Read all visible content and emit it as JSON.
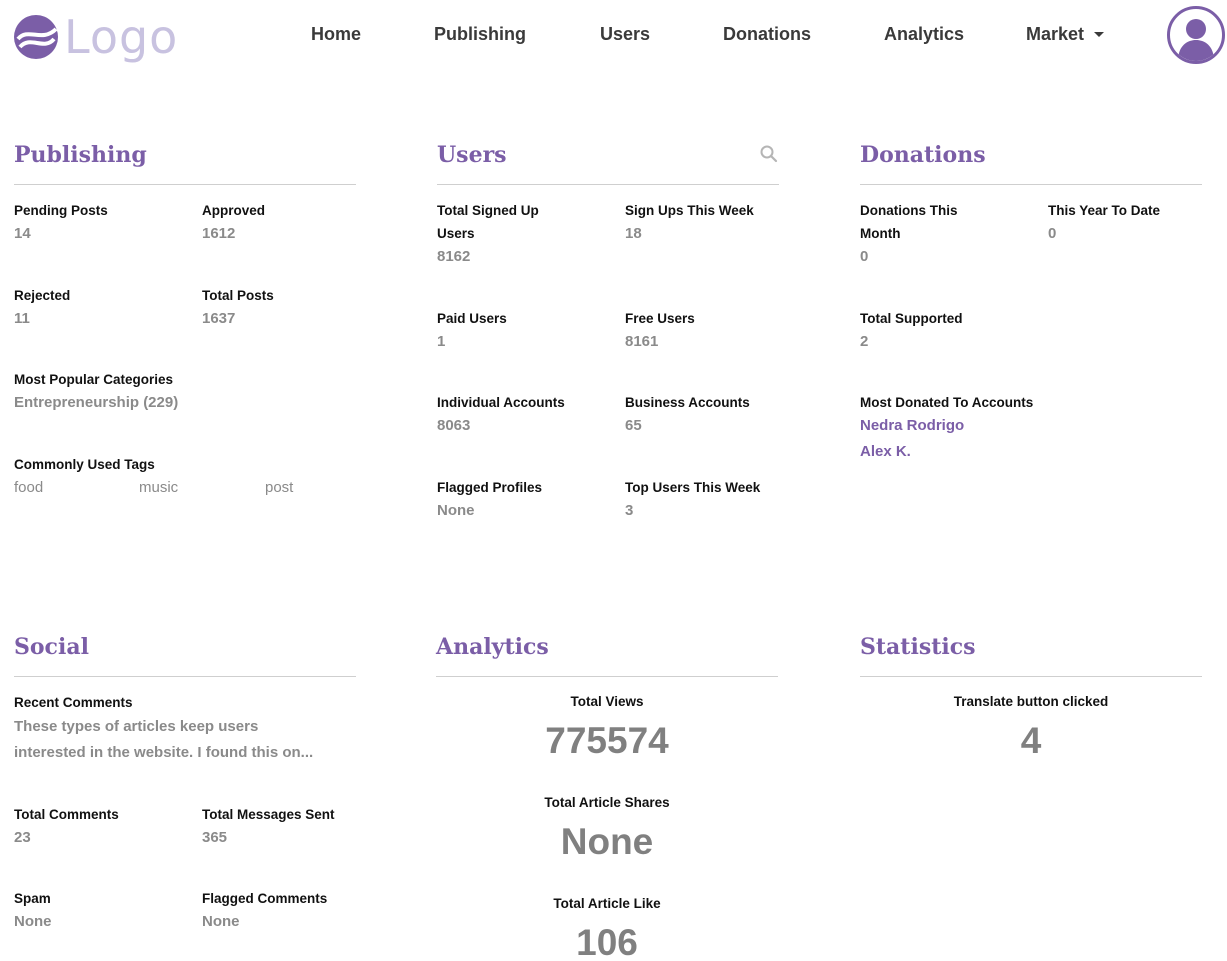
{
  "nav": {
    "logo_text": "Logo",
    "items": [
      "Home",
      "Publishing",
      "Users",
      "Donations",
      "Analytics",
      "Market"
    ]
  },
  "publishing": {
    "title": "Publishing",
    "pending_label": "Pending Posts",
    "pending_value": "14",
    "approved_label": "Approved",
    "approved_value": "1612",
    "rejected_label": "Rejected",
    "rejected_value": "11",
    "total_label": "Total Posts",
    "total_value": "1637",
    "categories_label": "Most Popular Categories",
    "categories_value": "Entrepreneurship (229)",
    "tags_label": "Commonly Used Tags",
    "tags": [
      "food",
      "music",
      "post"
    ]
  },
  "users": {
    "title": "Users",
    "total_label_1": "Total Signed Up",
    "total_label_2": "Users",
    "total_value": "8162",
    "signups_label": "Sign Ups This Week",
    "signups_value": "18",
    "paid_label": "Paid Users",
    "paid_value": "1",
    "free_label": "Free Users",
    "free_value": "8161",
    "individual_label": "Individual Accounts",
    "individual_value": "8063",
    "business_label": "Business Accounts",
    "business_value": "65",
    "flagged_label": "Flagged Profiles",
    "flagged_value": "None",
    "top_label": "Top Users This Week",
    "top_value": "3"
  },
  "donations": {
    "title": "Donations",
    "month_label_1": "Donations This",
    "month_label_2": "Month",
    "month_value": "0",
    "ytd_label": "This Year To Date",
    "ytd_value": "0",
    "supported_label": "Total Supported",
    "supported_value": "2",
    "most_label": "Most Donated To Accounts",
    "accounts": [
      "Nedra Rodrigo",
      "Alex K."
    ]
  },
  "social": {
    "title": "Social",
    "recent_label": "Recent Comments",
    "recent_line_1": "These types of articles keep users",
    "recent_line_2": "interested in the website. I found this on...",
    "comments_label": "Total Comments",
    "comments_value": "23",
    "messages_label": "Total Messages Sent",
    "messages_value": "365",
    "spam_label": "Spam",
    "spam_value": "None",
    "flagged_label": "Flagged Comments",
    "flagged_value": "None"
  },
  "analytics": {
    "title": "Analytics",
    "views_label": "Total Views",
    "views_value": "775574",
    "shares_label": "Total Article Shares",
    "shares_value": "None",
    "likes_label": "Total Article Like",
    "likes_value": "106"
  },
  "statistics": {
    "title": "Statistics",
    "translate_label": "Translate button clicked",
    "translate_value": "4"
  },
  "colors": {
    "accent": "#7b5ea7",
    "logo_text": "#c8c2e0",
    "value_gray": "#8a8a8a",
    "rule": "#cfcfcf"
  }
}
